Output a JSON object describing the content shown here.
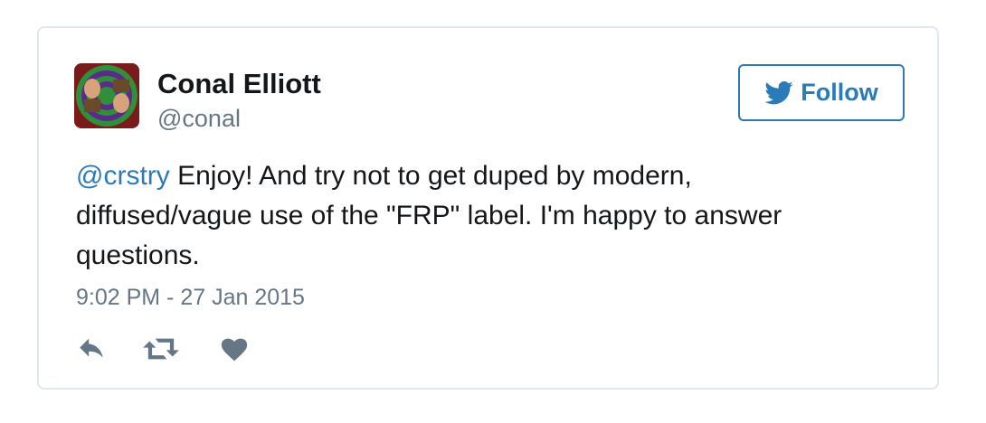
{
  "author": {
    "name": "Conal Elliott",
    "handle": "@conal",
    "avatar_icon": "avatar-photo"
  },
  "follow_button": {
    "label": "Follow",
    "icon": "twitter-bird-icon",
    "color": "#2b7bb9"
  },
  "tweet": {
    "mention": "@crstry",
    "text": " Enjoy! And try not to get duped by modern, diffused/vague use of the \"FRP\" label. I'm happy to answer questions.",
    "timestamp": "9:02 PM - 27 Jan 2015"
  },
  "actions": [
    {
      "icon": "reply-icon"
    },
    {
      "icon": "retweet-icon"
    },
    {
      "icon": "like-heart-icon"
    }
  ],
  "colors": {
    "link": "#2b7bb9",
    "secondary_text": "#657786",
    "border": "#e1e8ed",
    "icon": "#657786"
  }
}
